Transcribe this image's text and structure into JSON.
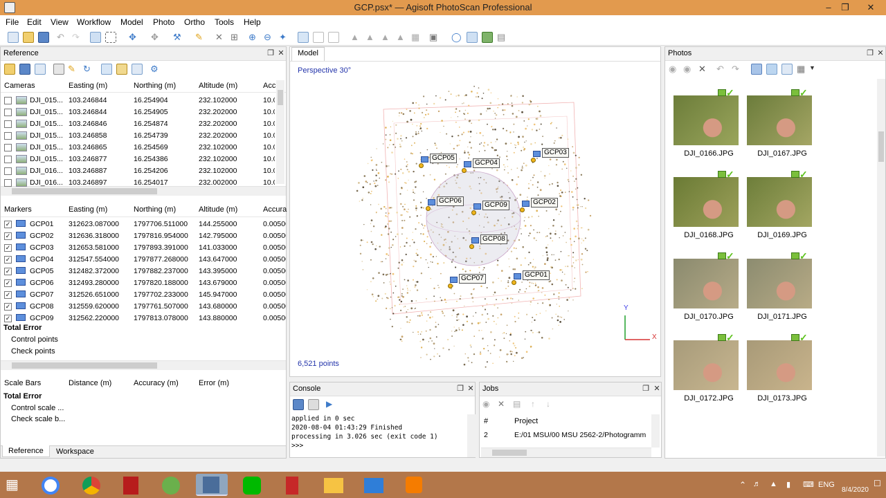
{
  "window": {
    "title": "GCP.psx* — Agisoft PhotoScan Professional"
  },
  "menu": [
    "File",
    "Edit",
    "View",
    "Workflow",
    "Model",
    "Photo",
    "Ortho",
    "Tools",
    "Help"
  ],
  "reference": {
    "title": "Reference",
    "cameras_headers": [
      "Cameras",
      "Easting (m)",
      "Northing (m)",
      "Altitude (m)",
      "Acc"
    ],
    "cameras": [
      {
        "name": "DJI_015...",
        "easting": "103.246844",
        "northing": "16.254904",
        "altitude": "232.102000",
        "acc": "10.0"
      },
      {
        "name": "DJI_015...",
        "easting": "103.246844",
        "northing": "16.254905",
        "altitude": "232.202000",
        "acc": "10.0"
      },
      {
        "name": "DJI_015...",
        "easting": "103.246846",
        "northing": "16.254874",
        "altitude": "232.202000",
        "acc": "10.0"
      },
      {
        "name": "DJI_015...",
        "easting": "103.246858",
        "northing": "16.254739",
        "altitude": "232.202000",
        "acc": "10.0"
      },
      {
        "name": "DJI_015...",
        "easting": "103.246865",
        "northing": "16.254569",
        "altitude": "232.102000",
        "acc": "10.0"
      },
      {
        "name": "DJI_015...",
        "easting": "103.246877",
        "northing": "16.254386",
        "altitude": "232.102000",
        "acc": "10.0"
      },
      {
        "name": "DJI_016...",
        "easting": "103.246887",
        "northing": "16.254206",
        "altitude": "232.102000",
        "acc": "10.0"
      },
      {
        "name": "DJI_016...",
        "easting": "103.246897",
        "northing": "16.254017",
        "altitude": "232.002000",
        "acc": "10.0"
      }
    ],
    "markers_headers": [
      "Markers",
      "Easting (m)",
      "Northing (m)",
      "Altitude (m)",
      "Accura"
    ],
    "markers": [
      {
        "name": "GCP01",
        "easting": "312623.087000",
        "northing": "1797706.511000",
        "altitude": "144.255000",
        "acc": "0.00500"
      },
      {
        "name": "GCP02",
        "easting": "312636.318000",
        "northing": "1797816.954000",
        "altitude": "142.795000",
        "acc": "0.00500"
      },
      {
        "name": "GCP03",
        "easting": "312653.581000",
        "northing": "1797893.391000",
        "altitude": "141.033000",
        "acc": "0.00500"
      },
      {
        "name": "GCP04",
        "easting": "312547.554000",
        "northing": "1797877.268000",
        "altitude": "143.647000",
        "acc": "0.00500"
      },
      {
        "name": "GCP05",
        "easting": "312482.372000",
        "northing": "1797882.237000",
        "altitude": "143.395000",
        "acc": "0.00500"
      },
      {
        "name": "GCP06",
        "easting": "312493.280000",
        "northing": "1797820.188000",
        "altitude": "143.679000",
        "acc": "0.00500"
      },
      {
        "name": "GCP07",
        "easting": "312526.651000",
        "northing": "1797702.233000",
        "altitude": "145.947000",
        "acc": "0.00500"
      },
      {
        "name": "GCP08",
        "easting": "312559.620000",
        "northing": "1797761.507000",
        "altitude": "143.680000",
        "acc": "0.00500"
      },
      {
        "name": "GCP09",
        "easting": "312562.220000",
        "northing": "1797813.078000",
        "altitude": "143.880000",
        "acc": "0.00500"
      }
    ],
    "total_error": "Total Error",
    "control_points": "Control points",
    "check_points": "Check points",
    "scalebars_headers": [
      "Scale Bars",
      "Distance (m)",
      "Accuracy (m)",
      "Error (m)"
    ],
    "scale_total_error": "Total Error",
    "control_scale": "Control scale ...",
    "check_scale": "Check scale b...",
    "tabs": [
      "Reference",
      "Workspace"
    ]
  },
  "model": {
    "tab": "Model",
    "perspective": "Perspective 30°",
    "points": "6,521 points",
    "axis_y": "Y",
    "axis_x": "X",
    "gcps": [
      "GCP05",
      "GCP04",
      "GCP03",
      "GCP06",
      "GCP09",
      "GCP02",
      "GCP08",
      "GCP07",
      "GCP01"
    ]
  },
  "console": {
    "title": "Console",
    "lines": [
      "applied in 0 sec",
      "2020-08-04 01:43:29 Finished",
      "processing in 3.026 sec (exit code 1)",
      ">>>"
    ]
  },
  "jobs": {
    "title": "Jobs",
    "headers": [
      "#",
      "Project"
    ],
    "rows": [
      {
        "num": "2",
        "project": "E:/01 MSU/00 MSU 2562-2/Photogramm"
      }
    ]
  },
  "photos": {
    "title": "Photos",
    "items": [
      "DJI_0166.JPG",
      "DJI_0167.JPG",
      "DJI_0168.JPG",
      "DJI_0169.JPG",
      "DJI_0170.JPG",
      "DJI_0171.JPG",
      "DJI_0172.JPG",
      "DJI_0173.JPG"
    ]
  },
  "taskbar": {
    "lang": "ENG",
    "date": "8/4/2020"
  },
  "colors": {
    "titlebar": "#e29a4e",
    "taskbar": "#b3774a",
    "accent": "#2b78d8",
    "check": "#5ec21e"
  }
}
